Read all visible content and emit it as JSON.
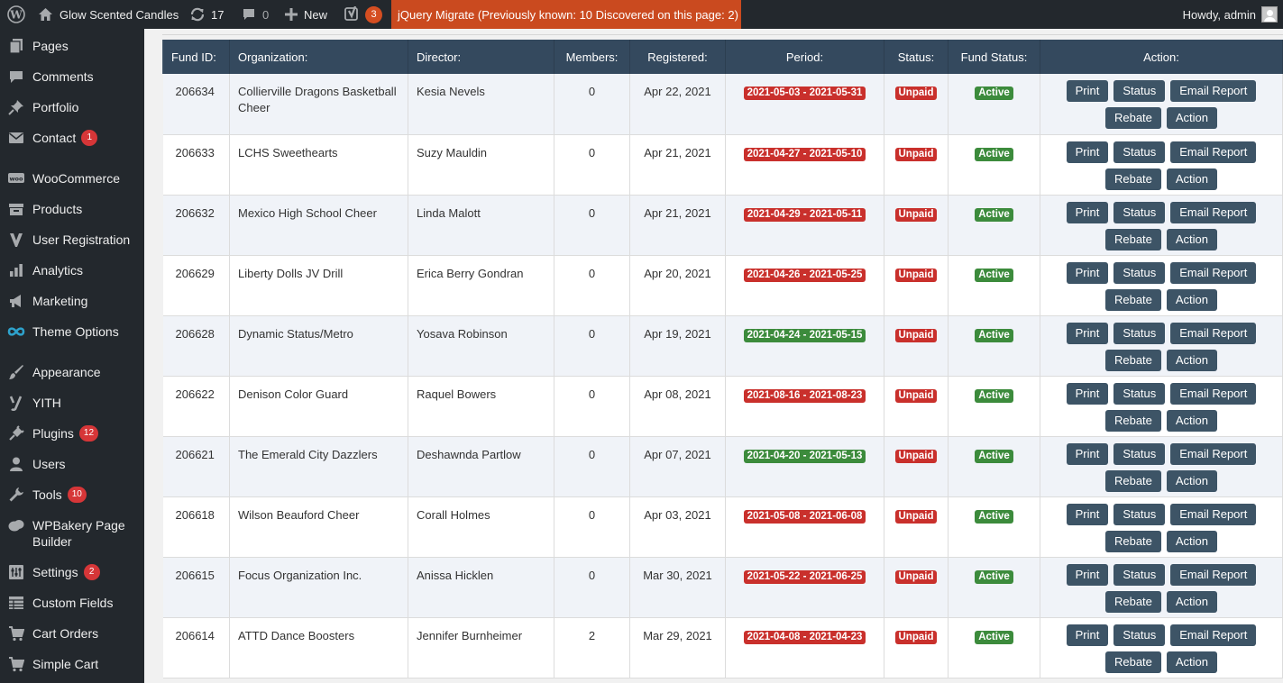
{
  "adminbar": {
    "site_name": "Glow Scented Candles",
    "updates_count": "17",
    "comments_count": "0",
    "new_label": "New",
    "yoast_count": "3",
    "jquery_notice": "jQuery Migrate (Previously known: 10 Discovered on this page: 2)",
    "howdy": "Howdy, admin"
  },
  "sidebar": {
    "items": [
      {
        "label": "Pages",
        "icon": "pages-icon"
      },
      {
        "label": "Comments",
        "icon": "comments-icon"
      },
      {
        "label": "Portfolio",
        "icon": "pin-icon"
      },
      {
        "label": "Contact",
        "icon": "mail-icon",
        "badge": "1"
      },
      {
        "label": "WooCommerce",
        "icon": "woocommerce-icon"
      },
      {
        "label": "Products",
        "icon": "archive-icon"
      },
      {
        "label": "User Registration",
        "icon": "user-registration-icon"
      },
      {
        "label": "Analytics",
        "icon": "bar-chart-icon"
      },
      {
        "label": "Marketing",
        "icon": "megaphone-icon"
      },
      {
        "label": "Theme Options",
        "icon": "infinity-icon"
      },
      {
        "label": "Appearance",
        "icon": "paintbrush-icon"
      },
      {
        "label": "YITH",
        "icon": "yith-icon"
      },
      {
        "label": "Plugins",
        "icon": "plug-icon",
        "badge": "12"
      },
      {
        "label": "Users",
        "icon": "user-icon"
      },
      {
        "label": "Tools",
        "icon": "wrench-icon",
        "badge": "10"
      },
      {
        "label": "WPBakery Page Builder",
        "icon": "wpbakery-icon"
      },
      {
        "label": "Settings",
        "icon": "sliders-icon",
        "badge": "2"
      },
      {
        "label": "Custom Fields",
        "icon": "table-icon"
      },
      {
        "label": "Cart Orders",
        "icon": "cart-icon"
      },
      {
        "label": "Simple Cart",
        "icon": "cart-icon"
      }
    ]
  },
  "table": {
    "headers": {
      "fund_id": "Fund ID:",
      "organization": "Organization:",
      "director": "Director:",
      "members": "Members:",
      "registered": "Registered:",
      "period": "Period:",
      "status": "Status:",
      "fund_status": "Fund Status:",
      "action": "Action:"
    },
    "action_labels": {
      "print": "Print",
      "status": "Status",
      "email_report": "Email Report",
      "rebate": "Rebate",
      "action": "Action"
    },
    "colors": {
      "header_bg": "#34495e",
      "badge_red": "#c9302c",
      "badge_green": "#3c8b3c",
      "button_bg": "#3d5466"
    },
    "rows": [
      {
        "fund_id": "206634",
        "organization": "Collierville Dragons Basketball Cheer",
        "director": "Kesia Nevels",
        "members": "0",
        "registered": "Apr 22, 2021",
        "period": "2021-05-03 - 2021-05-31",
        "period_color": "red",
        "status": "Unpaid",
        "fund_status": "Active"
      },
      {
        "fund_id": "206633",
        "organization": "LCHS Sweethearts",
        "director": "Suzy Mauldin",
        "members": "0",
        "registered": "Apr 21, 2021",
        "period": "2021-04-27 - 2021-05-10",
        "period_color": "red",
        "status": "Unpaid",
        "fund_status": "Active"
      },
      {
        "fund_id": "206632",
        "organization": "Mexico High School Cheer",
        "director": "Linda Malott",
        "members": "0",
        "registered": "Apr 21, 2021",
        "period": "2021-04-29 - 2021-05-11",
        "period_color": "red",
        "status": "Unpaid",
        "fund_status": "Active"
      },
      {
        "fund_id": "206629",
        "organization": "Liberty Dolls JV Drill",
        "director": "Erica Berry Gondran",
        "members": "0",
        "registered": "Apr 20, 2021",
        "period": "2021-04-26 - 2021-05-25",
        "period_color": "red",
        "status": "Unpaid",
        "fund_status": "Active"
      },
      {
        "fund_id": "206628",
        "organization": "Dynamic Status/Metro",
        "director": "Yosava Robinson",
        "members": "0",
        "registered": "Apr 19, 2021",
        "period": "2021-04-24 - 2021-05-15",
        "period_color": "green",
        "status": "Unpaid",
        "fund_status": "Active"
      },
      {
        "fund_id": "206622",
        "organization": "Denison Color Guard",
        "director": "Raquel Bowers",
        "members": "0",
        "registered": "Apr 08, 2021",
        "period": "2021-08-16 - 2021-08-23",
        "period_color": "red",
        "status": "Unpaid",
        "fund_status": "Active"
      },
      {
        "fund_id": "206621",
        "organization": "The Emerald City Dazzlers",
        "director": "Deshawnda Partlow",
        "members": "0",
        "registered": "Apr 07, 2021",
        "period": "2021-04-20 - 2021-05-13",
        "period_color": "green",
        "status": "Unpaid",
        "fund_status": "Active"
      },
      {
        "fund_id": "206618",
        "organization": "Wilson Beauford Cheer",
        "director": "Corall Holmes",
        "members": "0",
        "registered": "Apr 03, 2021",
        "period": "2021-05-08 - 2021-06-08",
        "period_color": "red",
        "status": "Unpaid",
        "fund_status": "Active"
      },
      {
        "fund_id": "206615",
        "organization": "Focus Organization Inc.",
        "director": "Anissa Hicklen",
        "members": "0",
        "registered": "Mar 30, 2021",
        "period": "2021-05-22 - 2021-06-25",
        "period_color": "red",
        "status": "Unpaid",
        "fund_status": "Active"
      },
      {
        "fund_id": "206614",
        "organization": "ATTD Dance Boosters",
        "director": "Jennifer Burnheimer",
        "members": "2",
        "registered": "Mar 29, 2021",
        "period": "2021-04-08 - 2021-04-23",
        "period_color": "red",
        "status": "Unpaid",
        "fund_status": "Active"
      }
    ]
  }
}
